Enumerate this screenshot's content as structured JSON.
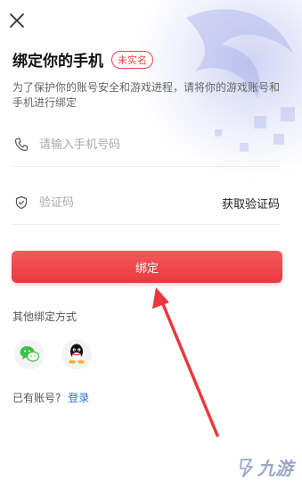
{
  "header": {
    "title": "绑定你的手机",
    "badge": "未实名",
    "close_icon": "close-icon"
  },
  "description": "为了保护你的账号安全和游戏进程，请将你的游戏账号和手机进行绑定",
  "phone_field": {
    "placeholder": "请输入手机号码",
    "value": "",
    "icon": "phone-icon"
  },
  "code_field": {
    "placeholder": "验证码",
    "value": "",
    "icon": "shield-icon",
    "get_code_label": "获取验证码"
  },
  "bind_button": {
    "label": "绑定"
  },
  "other_methods": {
    "label": "其他绑定方式",
    "items": [
      {
        "name": "wechat",
        "icon": "wechat-icon",
        "color": "#3cc34a"
      },
      {
        "name": "qq",
        "icon": "qq-icon",
        "color": "#111111"
      }
    ]
  },
  "account": {
    "prompt": "已有账号?",
    "login_label": "登录",
    "login_color": "#2f6fe0"
  },
  "colors": {
    "accent": "#e8393f",
    "badge": "#e84545",
    "annotation_arrow": "#e8393f"
  },
  "watermark": {
    "text": "九游"
  }
}
